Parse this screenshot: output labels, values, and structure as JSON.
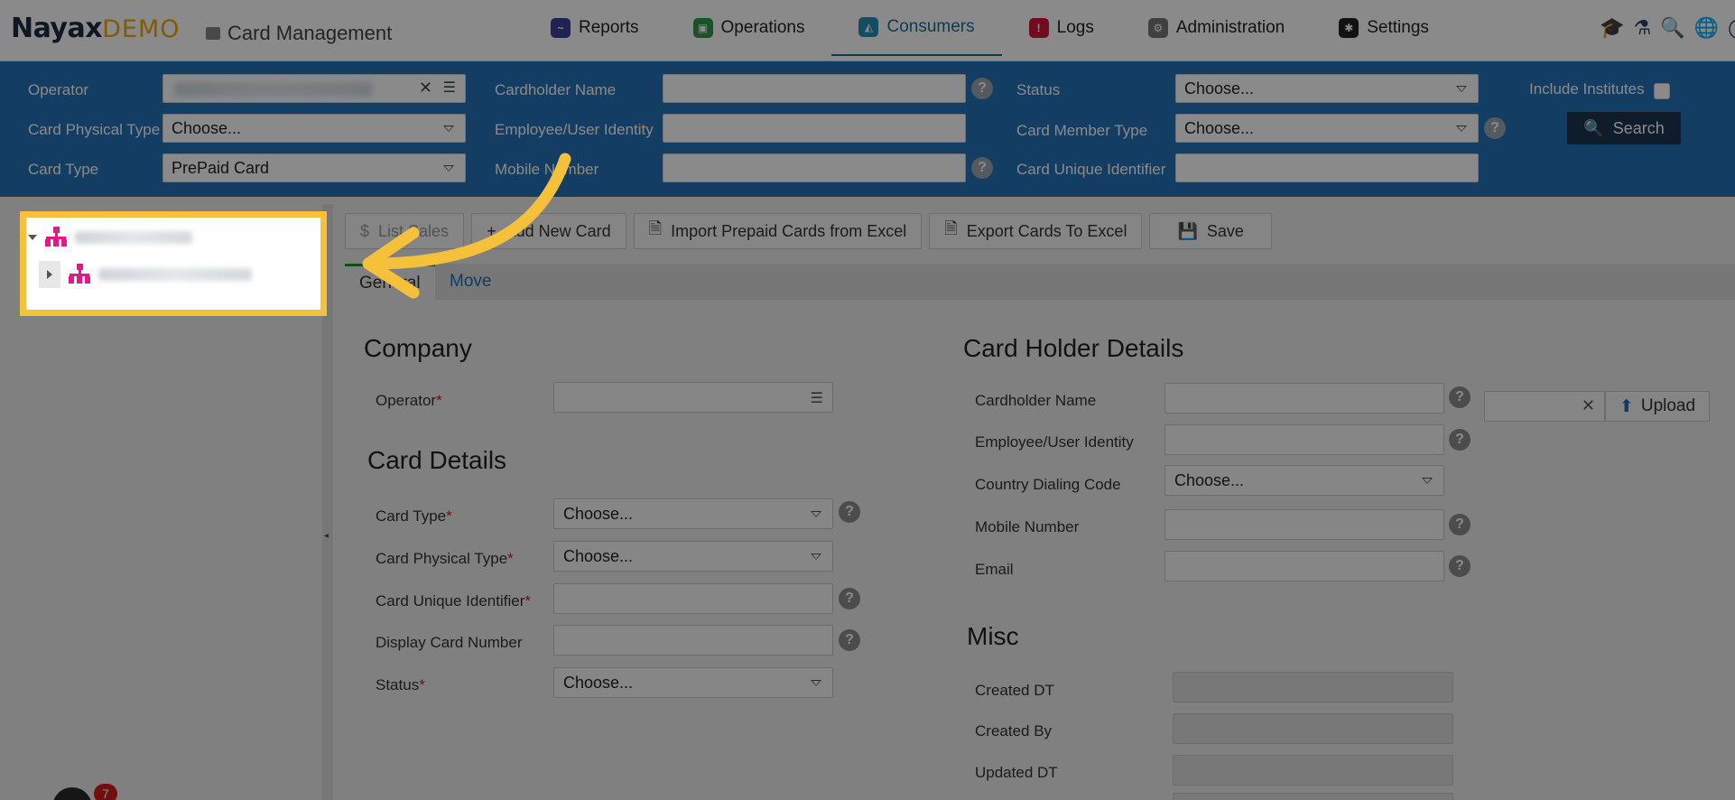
{
  "app": {
    "logo_main": "Nayax",
    "logo_suffix": "DEMO",
    "page_title": "Card Management"
  },
  "nav": [
    {
      "label": "Reports",
      "color": "#3b3f9c"
    },
    {
      "label": "Operations",
      "color": "#2f9a4a"
    },
    {
      "label": "Consumers",
      "color": "#2a8db8",
      "active": true
    },
    {
      "label": "Logs",
      "color": "#d0163c"
    },
    {
      "label": "Administration",
      "color": "#777777"
    },
    {
      "label": "Settings",
      "color": "#222222"
    }
  ],
  "filters": {
    "operator_label": "Operator",
    "card_physical_type_label": "Card Physical Type",
    "card_physical_type_value": "Choose...",
    "card_type_label": "Card Type",
    "card_type_value": "PrePaid Card",
    "cardholder_name_label": "Cardholder Name",
    "employee_identity_label": "Employee/User Identity",
    "mobile_number_label": "Mobile Number",
    "status_label": "Status",
    "status_value": "Choose...",
    "card_member_type_label": "Card Member Type",
    "card_member_type_value": "Choose...",
    "card_unique_identifier_label": "Card Unique Identifier",
    "include_institutes_label": "Include Institutes",
    "search_label": "Search"
  },
  "toolbar": {
    "list_sales": "List Sales",
    "add_new_card": "Add New Card",
    "import_prepaid": "Import Prepaid Cards from Excel",
    "export_cards": "Export Cards To Excel",
    "save": "Save"
  },
  "tabs": {
    "general": "General",
    "move": "Move"
  },
  "company": {
    "heading": "Company",
    "operator_label": "Operator"
  },
  "card_details": {
    "heading": "Card Details",
    "card_type_label": "Card Type",
    "card_type_value": "Choose...",
    "card_physical_type_label": "Card Physical Type",
    "card_physical_type_value": "Choose...",
    "card_unique_identifier_label": "Card Unique Identifier",
    "display_card_number_label": "Display Card Number",
    "status_label": "Status",
    "status_value": "Choose..."
  },
  "card_holder": {
    "heading": "Card Holder Details",
    "cardholder_name_label": "Cardholder Name",
    "employee_identity_label": "Employee/User Identity",
    "country_dialing_code_label": "Country Dialing Code",
    "country_dialing_code_value": "Choose...",
    "mobile_number_label": "Mobile Number",
    "email_label": "Email",
    "upload_label": "Upload"
  },
  "misc": {
    "heading": "Misc",
    "created_dt_label": "Created DT",
    "created_by_label": "Created By",
    "updated_dt_label": "Updated DT"
  },
  "notification_count": "7",
  "required_marker": "*"
}
